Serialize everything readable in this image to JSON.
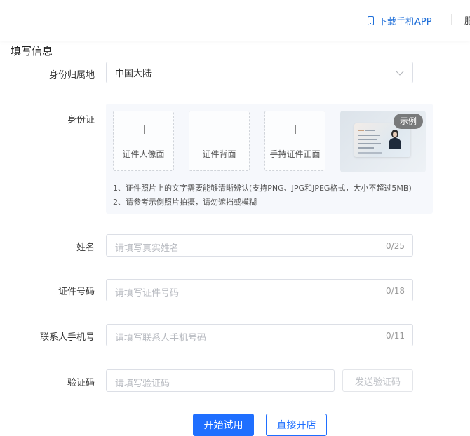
{
  "header": {
    "download_app_label": "下载手机APP",
    "cut_text": "服",
    "download_icon": "phone-icon"
  },
  "form": {
    "section_title": "填写信息",
    "region": {
      "label": "身份归属地",
      "value": "中国大陆"
    },
    "id_card": {
      "label": "身份证",
      "uploads": [
        {
          "label": "证件人像面"
        },
        {
          "label": "证件背面"
        },
        {
          "label": "手持证件正面"
        }
      ],
      "sample_badge": "示例",
      "notes": [
        "1、证件照片上的文字需要能够清晰辨认(支持PNG、JPG和JPEG格式，大小不超过5MB)",
        "2、请参考示例照片拍摄，请勿遮挡或模糊"
      ]
    },
    "name": {
      "label": "姓名",
      "placeholder": "请填写真实姓名",
      "counter": "0/25"
    },
    "id_number": {
      "label": "证件号码",
      "placeholder": "请填写证件号码",
      "counter": "0/18"
    },
    "phone": {
      "label": "联系人手机号",
      "placeholder": "请填写联系人手机号码",
      "counter": "0/11"
    },
    "code": {
      "label": "验证码",
      "placeholder": "请填写验证码",
      "send_label": "发送验证码"
    }
  },
  "actions": {
    "start_trial": "开始试用",
    "open_store": "直接开店"
  },
  "colors": {
    "accent": "#1f6fff",
    "link": "#1f6fd9"
  }
}
